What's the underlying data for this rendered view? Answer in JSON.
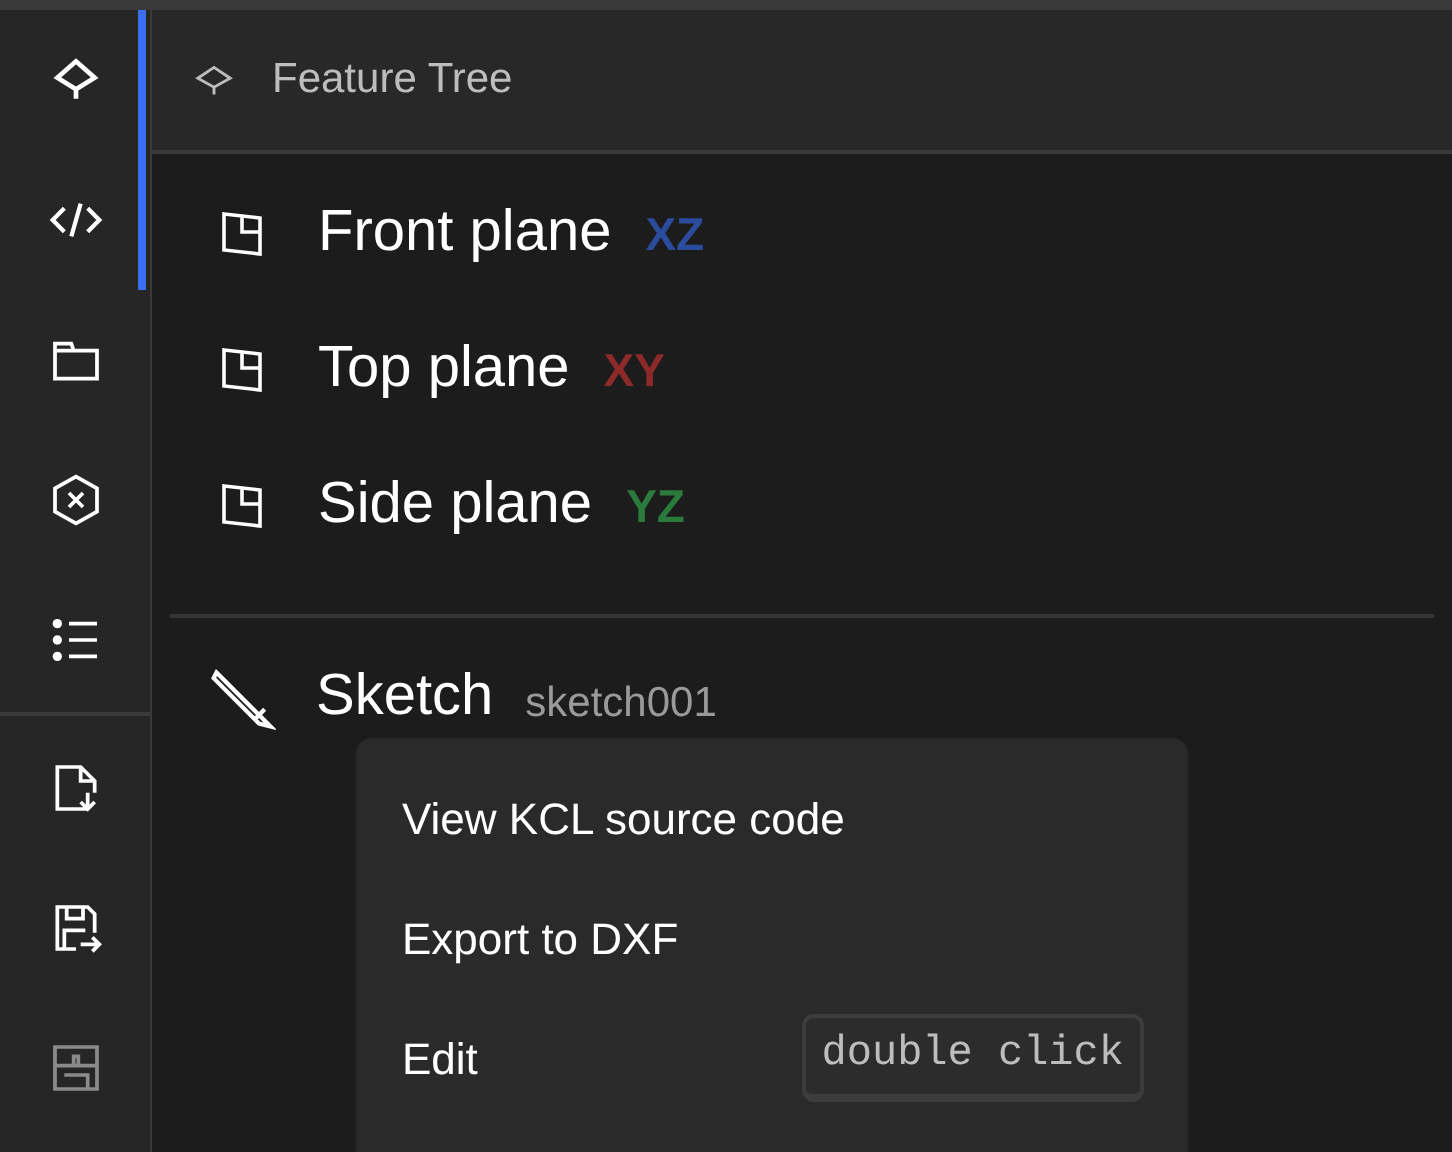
{
  "sidebar": {
    "items": [
      {
        "selected": true,
        "disabled": false
      },
      {
        "selected": true,
        "disabled": false
      },
      {
        "selected": false,
        "disabled": false
      },
      {
        "selected": false,
        "disabled": false
      },
      {
        "selected": false,
        "disabled": false
      },
      {
        "selected": false,
        "disabled": false
      },
      {
        "selected": false,
        "disabled": false
      },
      {
        "selected": false,
        "disabled": true
      }
    ]
  },
  "panel": {
    "title": "Feature Tree",
    "planes": [
      {
        "label": "Front plane",
        "tag": "XZ",
        "color": "#2b4c9c"
      },
      {
        "label": "Top plane",
        "tag": "XY",
        "color": "#8c2a2a"
      },
      {
        "label": "Side plane",
        "tag": "YZ",
        "color": "#2a7a3c"
      }
    ],
    "sketch": {
      "label": "Sketch",
      "name": "sketch001"
    }
  },
  "context_menu": {
    "items": [
      {
        "label": "View KCL source code"
      },
      {
        "label": "Export to DXF"
      },
      {
        "label": "Edit",
        "shortcut": "double click"
      }
    ]
  }
}
